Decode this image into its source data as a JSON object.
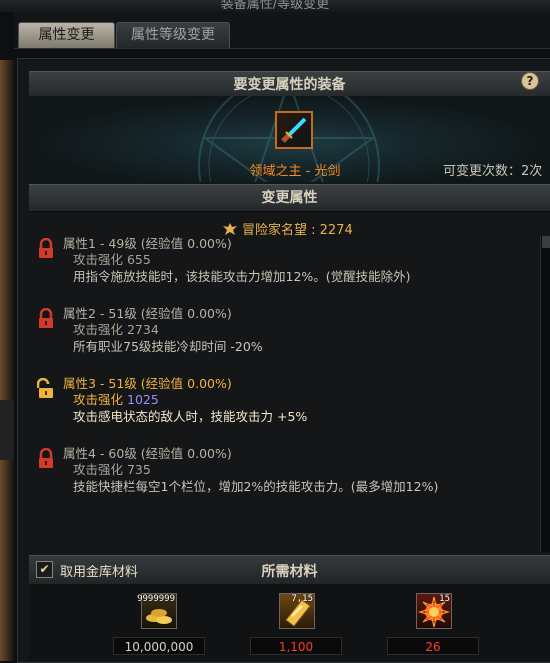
{
  "window": {
    "title": "装备属性/等级变更"
  },
  "tabs": [
    {
      "label": "属性变更",
      "active": true
    },
    {
      "label": "属性等级变更",
      "active": false
    }
  ],
  "equip_section": {
    "header": "要变更属性的装备",
    "help": "?",
    "item_name": "领域之主 - 光剑",
    "changes_left": "可变更次数：2次"
  },
  "change_section": {
    "header": "变更属性",
    "fame_label": "冒险家名望 : 2274"
  },
  "attributes": [
    {
      "name": "属性1 - 49级 (经验值 0.00%)",
      "stat": "攻击强化 655",
      "effect": "用指令施放技能时，该技能攻击力增加12%。(觉醒技能除外)",
      "locked": true
    },
    {
      "name": "属性2 - 51级 (经验值 0.00%)",
      "stat": "攻击强化 2734",
      "effect": "所有职业75级技能冷却时间 -20%",
      "locked": true
    },
    {
      "name": "属性3 - 51级 (经验值 0.00%)",
      "stat_label": "攻击强化",
      "stat_value": "1025",
      "effect": "攻击感电状态的敌人时，技能攻击力 +5%",
      "locked": false
    },
    {
      "name": "属性4 - 60级 (经验值 0.00%)",
      "stat": "攻击强化 735",
      "effect": "技能快捷栏每空1个栏位，增加2%的技能攻击力。(最多增加12%)",
      "locked": true
    }
  ],
  "materials": {
    "use_vault_label": "取用金库材料",
    "use_vault_checked": true,
    "header": "所需材料",
    "items": [
      {
        "icon": "gold-coins-icon",
        "badge": "9999999",
        "required": "10,000,000"
      },
      {
        "icon": "gold-card-icon",
        "badge": "7,15",
        "required": "1,100"
      },
      {
        "icon": "fire-burst-icon",
        "badge": "15",
        "required": "26"
      }
    ]
  },
  "colors": {
    "accent_orange": "#ff8a1c",
    "gold": "#e6b34a",
    "locked_red": "#d23a2c",
    "unlocked_gold": "#f0b43c",
    "highlight_purple": "#9c8cff",
    "required_red": "#ff3a2a"
  }
}
